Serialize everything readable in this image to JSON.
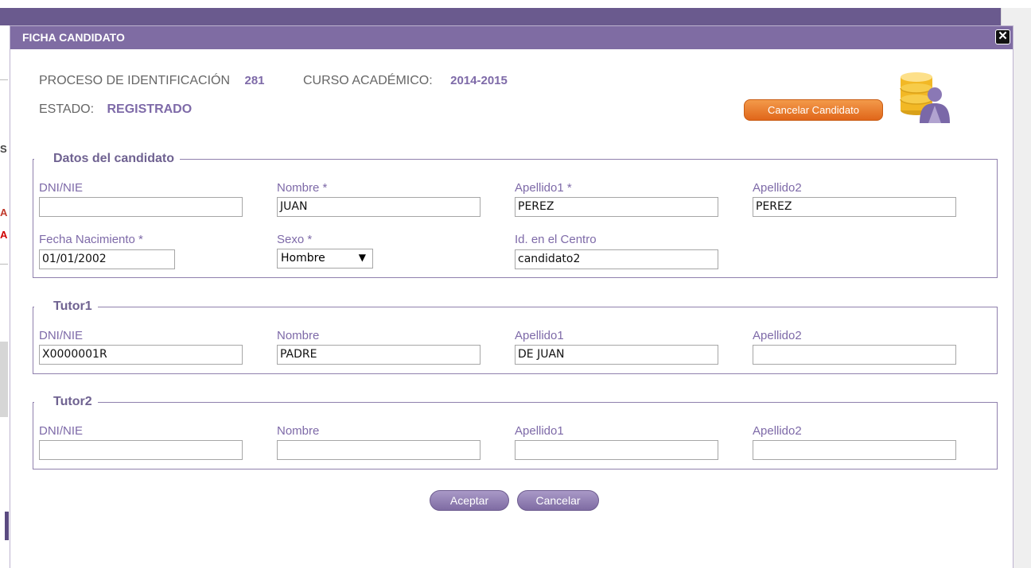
{
  "modal": {
    "title": "FICHA CANDIDATO",
    "close_glyph": "✕"
  },
  "info": {
    "proceso_label": "PROCESO DE IDENTIFICACIÓN",
    "proceso_value": "281",
    "curso_label": "CURSO ACADÉMICO:",
    "curso_value": "2014-2015",
    "estado_label": "ESTADO:",
    "estado_value": "REGISTRADO"
  },
  "cancel_candidate_label": "Cancelar Candidato",
  "datos_candidato": {
    "legend": "Datos del candidato",
    "dni_label": "DNI/NIE",
    "dni_value": "",
    "nombre_label": "Nombre *",
    "nombre_value": "JUAN",
    "apellido1_label": "Apellido1 *",
    "apellido1_value": "PEREZ",
    "apellido2_label": "Apellido2",
    "apellido2_value": "PEREZ",
    "fecha_label": "Fecha Nacimiento *",
    "fecha_value": "01/01/2002",
    "sexo_label": "Sexo *",
    "sexo_value": "Hombre",
    "idcentro_label": "Id. en el Centro",
    "idcentro_value": "candidato2"
  },
  "tutor1": {
    "legend": "Tutor1",
    "dni_label": "DNI/NIE",
    "dni_value": "X0000001R",
    "nombre_label": "Nombre",
    "nombre_value": "PADRE",
    "apellido1_label": "Apellido1",
    "apellido1_value": "DE JUAN",
    "apellido2_label": "Apellido2",
    "apellido2_value": ""
  },
  "tutor2": {
    "legend": "Tutor2",
    "dni_label": "DNI/NIE",
    "dni_value": "",
    "nombre_label": "Nombre",
    "nombre_value": "",
    "apellido1_label": "Apellido1",
    "apellido1_value": "",
    "apellido2_label": "Apellido2",
    "apellido2_value": ""
  },
  "actions": {
    "aceptar_label": "Aceptar",
    "cancelar_label": "Cancelar"
  },
  "background_fragments": {
    "frag1": "S",
    "frag2": "A",
    "frag3": "A"
  },
  "icons": {
    "close": "close-icon",
    "db_user": "database-user-icon",
    "select_arrow": "chevron-down-icon"
  },
  "colors": {
    "header_purple": "#7f6ca3",
    "label_purple": "#7e6aa8",
    "orange_button": "#e0661a"
  }
}
